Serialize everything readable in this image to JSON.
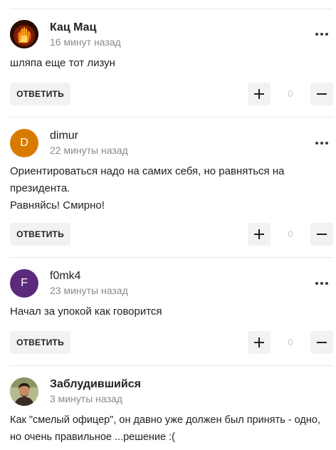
{
  "comments": [
    {
      "author": "Кац Мац",
      "time": "16 минут назад",
      "avatar": {
        "type": "image",
        "icon": "flaming-hand-icon"
      },
      "lines": [
        "шляпа еще тот лизун"
      ],
      "reply_label": "ОТВЕТИТЬ",
      "score": "0"
    },
    {
      "author": "dimur",
      "time": "22 минуты назад",
      "avatar": {
        "type": "letter",
        "letter": "D",
        "color": "#d97a00"
      },
      "lines": [
        "Ориентироваться надо на самих себя, но равняться на",
        "президента.",
        "Равняйсь! Смирно!"
      ],
      "reply_label": "ОТВЕТИТЬ",
      "score": "0"
    },
    {
      "author": "f0mk4",
      "time": "23 минуты назад",
      "avatar": {
        "type": "letter",
        "letter": "F",
        "color": "#5b2a7a"
      },
      "lines": [
        "Начал за упокой как говорится"
      ],
      "reply_label": "ОТВЕТИТЬ",
      "score": "0"
    },
    {
      "author": "Заблудившийся",
      "time": "3 минуты назад",
      "avatar": {
        "type": "image",
        "icon": "person-photo-icon"
      },
      "lines": [
        "Как \"смелый офицер\", он давно уже должен был принять - одно,",
        "но очень правильное ...решение :("
      ]
    }
  ],
  "icons": {
    "more": "more-dots-icon",
    "plus": "plus-icon",
    "minus": "minus-icon"
  },
  "colors": {
    "score": "#c8c8c8",
    "button_bg": "#f2f2f2",
    "time": "#8a8a8a"
  }
}
